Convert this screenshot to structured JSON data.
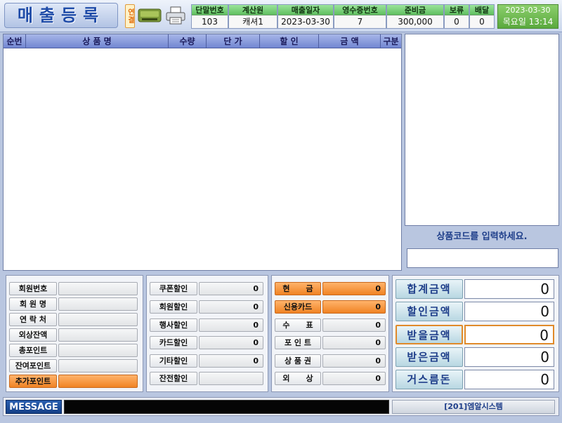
{
  "header": {
    "title": "매출등록",
    "connection_badge": "연결",
    "device_icon": "card-reader-icon",
    "printer_icon": "printer-icon",
    "info": [
      {
        "label": "단말번호",
        "value": "103"
      },
      {
        "label": "계산원",
        "value": "캐셔1"
      },
      {
        "label": "매출일자",
        "value": "2023-03-30"
      },
      {
        "label": "영수증번호",
        "value": "7"
      },
      {
        "label": "준비금",
        "value": "300,000"
      },
      {
        "label": "보류",
        "value": "0"
      },
      {
        "label": "배달",
        "value": "0"
      }
    ],
    "date": "2023-03-30",
    "weekday_time": "목요일 13:14"
  },
  "grid": {
    "columns": [
      "순번",
      "상 품 명",
      "수량",
      "단 가",
      "할 인",
      "금 액",
      "구분"
    ]
  },
  "input": {
    "prompt": "상품코드를 입력하세요.",
    "value": ""
  },
  "member": {
    "rows": [
      {
        "label": "회원번호",
        "value": ""
      },
      {
        "label": "회 원 명",
        "value": ""
      },
      {
        "label": "연 락 처",
        "value": ""
      },
      {
        "label": "외상잔액",
        "value": ""
      },
      {
        "label": "총포인트",
        "value": ""
      },
      {
        "label": "잔여포인트",
        "value": ""
      },
      {
        "label": "추가포인트",
        "value": ""
      }
    ]
  },
  "discounts": {
    "rows": [
      {
        "label": "쿠폰할인",
        "value": "0"
      },
      {
        "label": "회원할인",
        "value": "0"
      },
      {
        "label": "행사할인",
        "value": "0"
      },
      {
        "label": "카드할인",
        "value": "0"
      },
      {
        "label": "기타할인",
        "value": "0"
      },
      {
        "label": "잔전할인",
        "value": ""
      }
    ]
  },
  "payments": {
    "rows": [
      {
        "label": "현      금",
        "value": "0"
      },
      {
        "label": "신용카드",
        "value": "0"
      },
      {
        "label": "수      표",
        "value": "0"
      },
      {
        "label": "포 인 트",
        "value": "0"
      },
      {
        "label": "상 품 권",
        "value": "0"
      },
      {
        "label": "외      상",
        "value": "0"
      }
    ]
  },
  "totals": {
    "rows": [
      {
        "label": "합계금액",
        "value": "0"
      },
      {
        "label": "할인금액",
        "value": "0"
      },
      {
        "label": "받을금액",
        "value": "0"
      },
      {
        "label": "받은금액",
        "value": "0"
      },
      {
        "label": "거스름돈",
        "value": "0"
      }
    ]
  },
  "status": {
    "message_label": "MESSAGE",
    "message": "",
    "company": "[201]엠알시스템"
  },
  "colors": {
    "accent_orange": "#f08324",
    "header_green": "#5fbf5f",
    "title_blue": "#1e4ba8"
  }
}
